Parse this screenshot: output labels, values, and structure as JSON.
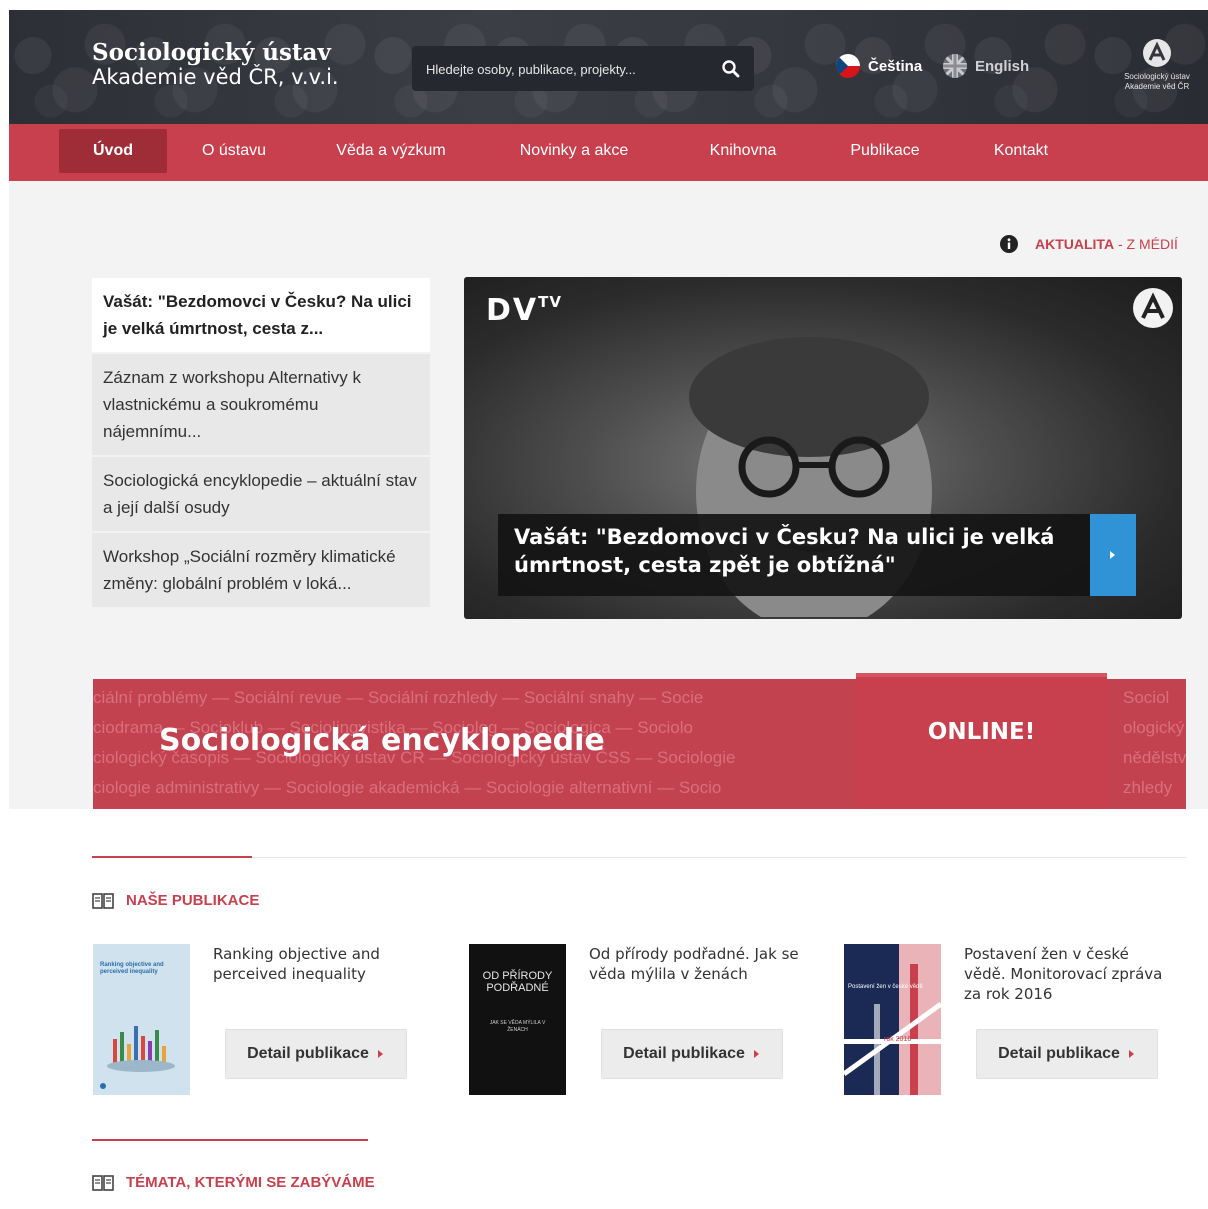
{
  "header": {
    "brand_line1": "Sociologický ústav",
    "brand_line2": "Akademie věd ČR, v.v.i.",
    "search_placeholder": "Hledejte osoby, publikace, projekty...",
    "lang_cz": "Čeština",
    "lang_en": "English",
    "logo_line1": "Sociologický ústav",
    "logo_line2": "Akademie věd ČR"
  },
  "nav": {
    "items": [
      "Úvod",
      "O ústavu",
      "Věda a výzkum",
      "Novinky a akce",
      "Knihovna",
      "Publikace",
      "Kontakt"
    ],
    "active_index": 0
  },
  "aktualita": {
    "label": "AKTUALITA",
    "separator": " - ",
    "source": "Z MÉDIÍ"
  },
  "news": [
    "Vašát: \"Bezdomovci v Česku? Na ulici je velká úmrtnost, cesta z...",
    "Záznam z workshopu Alternativy k vlastnickému a soukromému nájemnímu...",
    "Sociologická encyklopedie – aktuální stav a její další osudy",
    "Workshop „Sociální rozměry klimatické změny: globální problém v loká..."
  ],
  "hero": {
    "brand": "DV",
    "brand_sup": "TV",
    "caption": "Vašát: \"Bezdomovci v Česku? Na ulici je velká úmrtnost, cesta zpět je obtížná\""
  },
  "banner": {
    "title": "Sociologická encyklopedie",
    "online": "ONLINE!",
    "rows": [
      "ciální problémy  —  Sociální revue  —  Sociální rozhledy  —  Sociální snahy  —  Socie",
      "ciodrama  —  Socioklub  —  Sociolingvistika  —  Sociolog  —  Sociologica  —  Sociolo",
      "ciologický časopis  —  Sociologický ústav ČR  —  Sociologický ústav ČSS  —  Sociologie",
      "ciologie administrativy  —  Sociologie akademická  —  Sociologie alternativní  —  Socio"
    ],
    "rows_right": [
      "Sociol",
      "ologický",
      "nědělství",
      "zhledy"
    ]
  },
  "publications": {
    "heading": "NAŠE PUBLIKACE",
    "button_label": "Detail publikace",
    "items": [
      {
        "title": "Ranking objective and perceived inequality",
        "cover_title": "Ranking objective and perceived inequality"
      },
      {
        "title": "Od přírody podřadné. Jak se věda mýlila v ženách",
        "cover_title": "OD PŘÍRODY PODŘADNÉ",
        "cover_sub": "JAK SE VĚDA MÝLILA V ŽENÁCH"
      },
      {
        "title": "Postavení žen v české vědě. Monitorovací zpráva za rok 2016",
        "cover_title": "Postavení žen v české vědě",
        "cover_sub": "rok 2016"
      }
    ]
  },
  "topics": {
    "heading": "TÉMATA, KTERÝMI SE ZABÝVÁME"
  },
  "colors": {
    "accent": "#c8404d",
    "accent_dark": "#9f2d38",
    "header_bg": "#34363d",
    "hero_button": "#2f93d6"
  }
}
